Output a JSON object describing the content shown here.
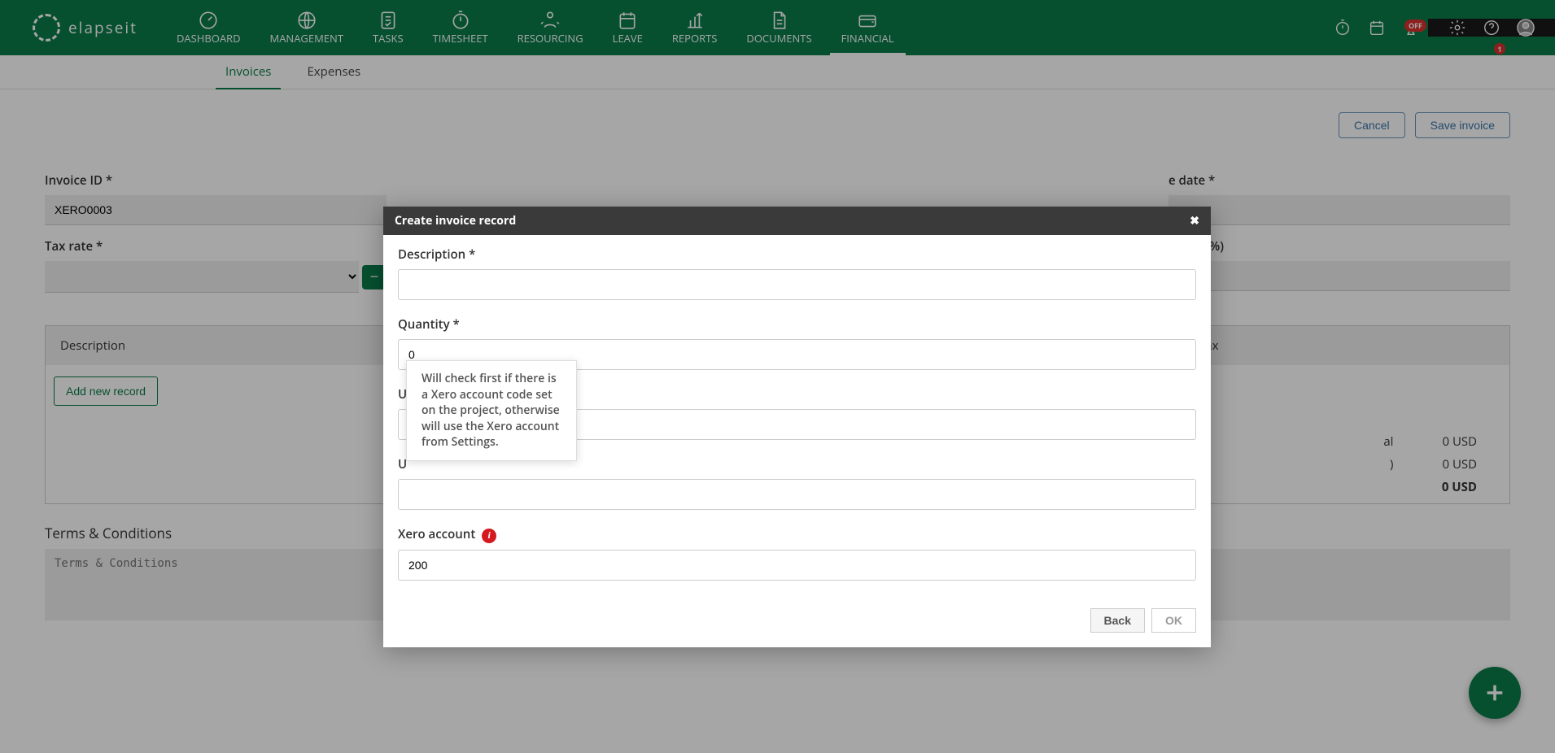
{
  "brand": "elapseit",
  "nav": [
    {
      "label": "DASHBOARD"
    },
    {
      "label": "MANAGEMENT"
    },
    {
      "label": "TASKS"
    },
    {
      "label": "TIMESHEET"
    },
    {
      "label": "RESOURCING"
    },
    {
      "label": "LEAVE"
    },
    {
      "label": "REPORTS"
    },
    {
      "label": "DOCUMENTS"
    },
    {
      "label": "FINANCIAL"
    }
  ],
  "header_right": {
    "off_badge": "OFF",
    "count_badge": "1"
  },
  "subnav": {
    "invoices": "Invoices",
    "expenses": "Expenses"
  },
  "actions": {
    "cancel": "Cancel",
    "save": "Save invoice"
  },
  "form": {
    "invoice_id_label": "Invoice ID *",
    "invoice_id_value": "XERO0003",
    "due_date_label_partial": "e date *",
    "tax_rate_label": "Tax rate *",
    "discount_label_partial": "count (%)"
  },
  "records": {
    "col_desc": "Description",
    "col_tax": "Tax",
    "add_new": "Add new record"
  },
  "totals": {
    "subtotal_label_partial": "al",
    "subtotal_value": "0 USD",
    "tax_label_partial": ")",
    "tax_value": "0 USD",
    "grand_value": "0 USD"
  },
  "terms": {
    "label": "Terms & Conditions",
    "placeholder": "Terms & Conditions"
  },
  "modal": {
    "title": "Create invoice record",
    "description_label": "Description *",
    "quantity_label": "Quantity *",
    "quantity_value": "0",
    "u1_label": "U",
    "u2_label": "U",
    "xero_label": "Xero account",
    "xero_value": "200",
    "tooltip": "Will check first if there is a Xero account code set on the project, otherwise will use the Xero account from Settings.",
    "back": "Back",
    "ok": "OK"
  }
}
